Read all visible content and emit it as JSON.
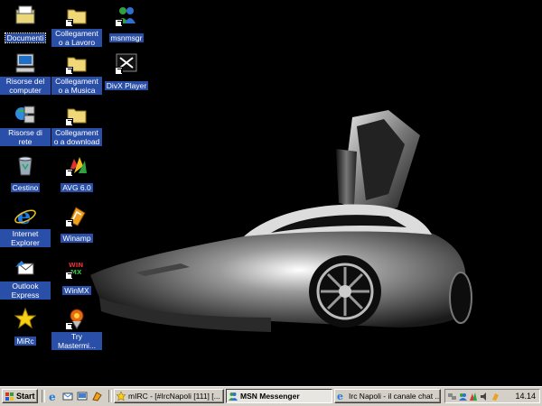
{
  "desktop": {
    "icons": [
      {
        "label": "Documenti",
        "icon": "my-documents-icon"
      },
      {
        "label": "Risorse del computer",
        "icon": "my-computer-icon"
      },
      {
        "label": "Risorse di rete",
        "icon": "network-places-icon"
      },
      {
        "label": "Cestino",
        "icon": "recycle-bin-icon"
      },
      {
        "label": "Internet Explorer",
        "icon": "internet-explorer-icon"
      },
      {
        "label": "Outlook Express",
        "icon": "outlook-express-icon"
      },
      {
        "label": "MiRc",
        "icon": "mirc-icon"
      },
      {
        "label": "Collegamento a Lavoro",
        "icon": "folder-shortcut-icon"
      },
      {
        "label": "Collegamento a Musica",
        "icon": "folder-shortcut-icon"
      },
      {
        "label": "Collegamento a download",
        "icon": "folder-shortcut-icon"
      },
      {
        "label": "AVG 6.0",
        "icon": "avg-antivirus-icon"
      },
      {
        "label": "Winamp",
        "icon": "winamp-icon"
      },
      {
        "label": "WinMX",
        "icon": "winmx-icon"
      },
      {
        "label": "Try Mastermi...",
        "icon": "mastermind-icon"
      },
      {
        "label": "msnmsgr",
        "icon": "msn-messenger-icon"
      },
      {
        "label": "DivX Player",
        "icon": "divx-player-icon"
      }
    ]
  },
  "taskbar": {
    "start_label": "Start",
    "quick_launch": [
      "internet-explorer-icon",
      "outlook-express-icon",
      "show-desktop-icon",
      "winamp-icon"
    ],
    "tasks": [
      {
        "label": "mIRC - [#IrcNapoli [111] [...",
        "icon": "mirc-icon",
        "active": false
      },
      {
        "label": "MSN Messenger",
        "icon": "msn-messenger-icon",
        "active": true
      },
      {
        "label": "Irc Napoli - il canale chat ...",
        "icon": "internet-explorer-icon",
        "active": false
      }
    ],
    "tray_icons": [
      "network-tray-icon",
      "msn-tray-icon",
      "avg-tray-icon",
      "volume-tray-icon",
      "winamp-tray-icon"
    ],
    "clock": "14.14"
  },
  "colors": {
    "desktop_bg": "#000000",
    "taskbar_bg": "#d4d0c8",
    "label_highlight": "#2a4fa8"
  }
}
